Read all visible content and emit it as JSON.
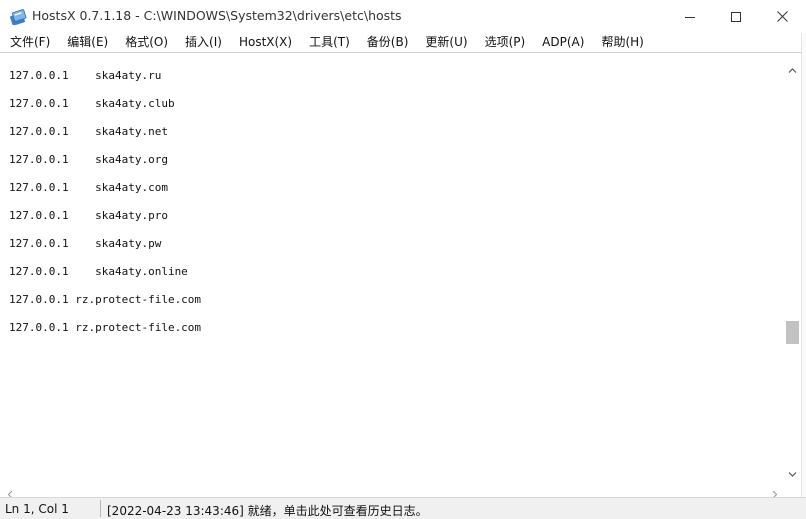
{
  "window": {
    "title": "HostsX 0.7.1.18 - C:\\WINDOWS\\System32\\drivers\\etc\\hosts",
    "app_icon": "hostsx-app-icon",
    "controls": {
      "minimize_icon": "minimize-icon",
      "maximize_icon": "maximize-icon",
      "close_icon": "close-icon"
    }
  },
  "menu": {
    "items": [
      {
        "label": "文件(F)"
      },
      {
        "label": "编辑(E)"
      },
      {
        "label": "格式(O)"
      },
      {
        "label": "插入(I)"
      },
      {
        "label": "HostX(X)"
      },
      {
        "label": "工具(T)"
      },
      {
        "label": "备份(B)"
      },
      {
        "label": "更新(U)"
      },
      {
        "label": "选项(P)"
      },
      {
        "label": "ADP(A)"
      },
      {
        "label": "帮助(H)"
      }
    ]
  },
  "editor": {
    "lines": [
      {
        "text": "127.0.0.1    ska4aty.ru"
      },
      {
        "text": "127.0.0.1    ska4aty.club"
      },
      {
        "text": "127.0.0.1    ska4aty.net"
      },
      {
        "text": "127.0.0.1    ska4aty.org"
      },
      {
        "text": "127.0.0.1    ska4aty.com"
      },
      {
        "text": "127.0.0.1    ska4aty.pro"
      },
      {
        "text": "127.0.0.1    ska4aty.pw"
      },
      {
        "text": "127.0.0.1    ska4aty.online"
      },
      {
        "text": "127.0.0.1 rz.protect-file.com"
      },
      {
        "text": "127.0.0.1 rz.protect-file.com"
      }
    ]
  },
  "statusbar": {
    "position": "Ln 1, Col 1",
    "message": "[2022-04-23 13:43:46] 就绪，单击此处可查看历史日志。"
  },
  "colors": {
    "scroll_thumb": "#c2c2c2",
    "statusbar_bg": "#f0f0f0"
  }
}
